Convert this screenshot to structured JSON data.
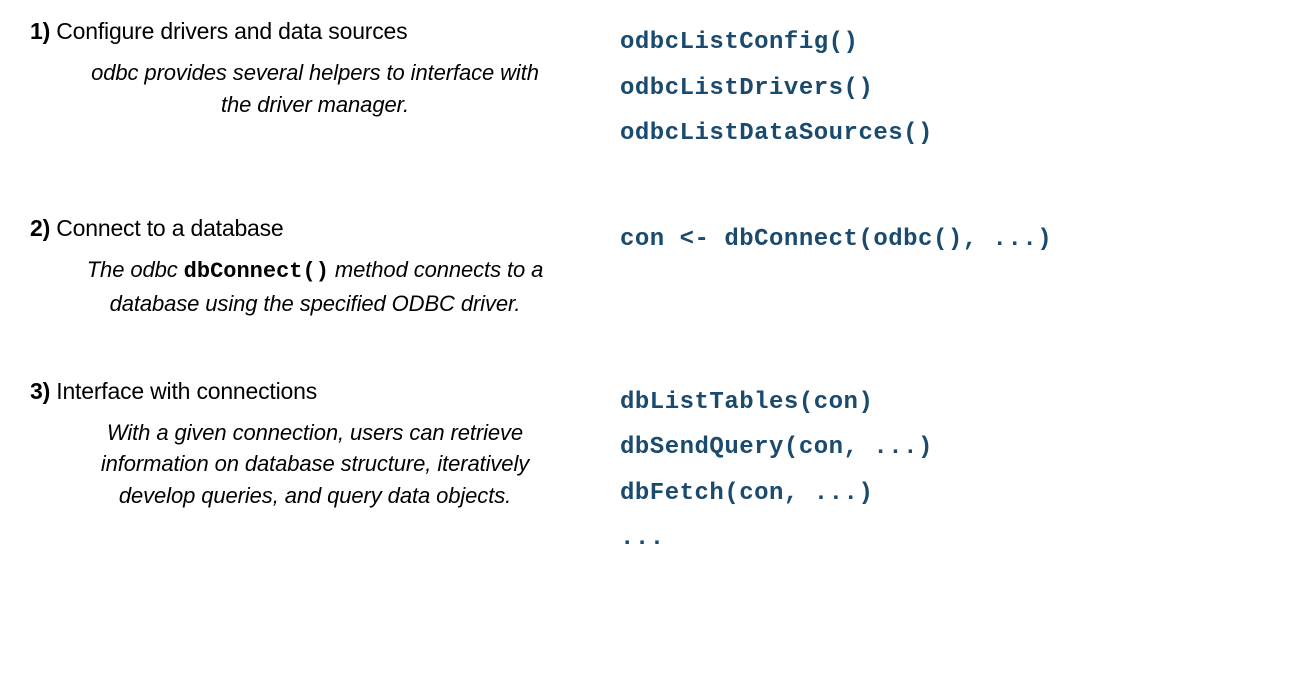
{
  "sections": [
    {
      "num": "1)",
      "title": "Configure drivers and data sources",
      "desc_before": "odbc provides several helpers to interface with the driver manager.",
      "desc_code": "",
      "desc_after": "",
      "code": [
        "odbcListConfig()",
        "odbcListDrivers()",
        "odbcListDataSources()"
      ]
    },
    {
      "num": "2)",
      "title": "Connect to a database",
      "desc_before": "The odbc ",
      "desc_code": "dbConnect()",
      "desc_after": " method connects to a database using the specified ODBC driver.",
      "code": [
        "con <- dbConnect(odbc(), ...)"
      ]
    },
    {
      "num": "3)",
      "title": "Interface with connections",
      "desc_before": "With a given connection, users can retrieve information on database structure, iteratively develop queries, and query data objects.",
      "desc_code": "",
      "desc_after": "",
      "code": [
        "dbListTables(con)",
        "dbSendQuery(con, ...)",
        "dbFetch(con, ...)",
        "..."
      ]
    }
  ]
}
